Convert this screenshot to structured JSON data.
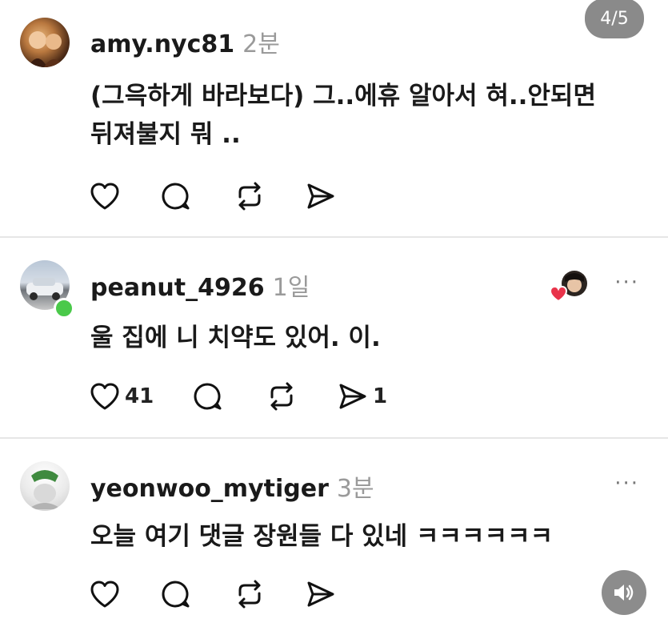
{
  "page_indicator": "4/5",
  "comments": [
    {
      "username": "amy.nyc81",
      "time": "2분",
      "text_line1": "(그윽하게 바라보다) 그..에휴 알아서 혀..안되면",
      "text_line2": "뒤져불지 뭐 ..",
      "like_count": "",
      "share_count": ""
    },
    {
      "username": "peanut_4926",
      "time": "1일",
      "text_line1": "울 집에 니 치약도 있어. 이.",
      "like_count": "41",
      "share_count": "1"
    },
    {
      "username": "yeonwoo_mytiger",
      "time": "3분",
      "text_line1": "오늘 여기 댓글 장원들 다 있네 ㅋㅋㅋㅋㅋㅋ"
    }
  ],
  "more_label": "···",
  "icons": {
    "like": "heart-icon",
    "comment": "comment-icon",
    "repost": "repost-icon",
    "share": "send-icon",
    "sound": "speaker-icon"
  },
  "colors": {
    "accent_heart": "#e8334a",
    "online": "#4ac94a",
    "indicator_bg": "#8a8a8a"
  }
}
